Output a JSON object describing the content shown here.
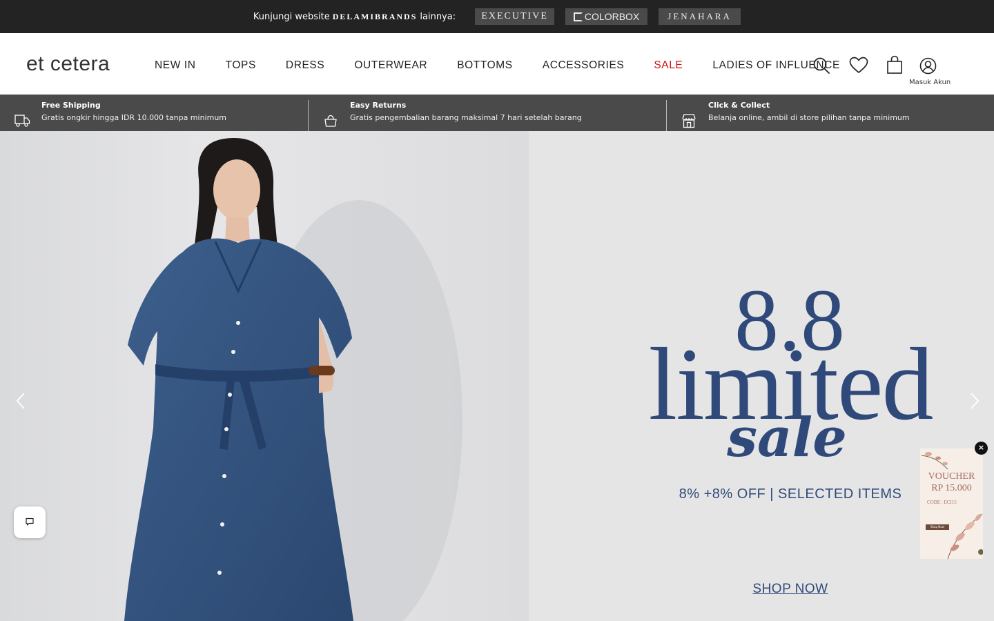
{
  "topbar": {
    "visit_text": "Kunjungi website",
    "group_brand": "DELAMIBRANDS",
    "suffix": "lainnya:",
    "brands": [
      "EXECUTIVE",
      "COLORBOX",
      "JENAHARA"
    ]
  },
  "header": {
    "logo": "et cetera",
    "nav": [
      "NEW IN",
      "TOPS",
      "DRESS",
      "OUTERWEAR",
      "BOTTOMS",
      "ACCESSORIES",
      "SALE",
      "LADIES OF INFLUENCE"
    ],
    "account_label": "Masuk Akun"
  },
  "info": {
    "items": [
      {
        "title": "Free Shipping",
        "desc": "Gratis ongkir hingga IDR 10.000 tanpa minimum",
        "icon": "truck-icon"
      },
      {
        "title": "Easy Returns",
        "desc": "Gratis pengembalian barang maksimal 7 hari setelah barang",
        "icon": "basket-icon"
      },
      {
        "title": "Click & Collect",
        "desc": "Belanja online, ambil di store pilihan tanpa minimum",
        "icon": "store-icon"
      }
    ]
  },
  "hero": {
    "headline_number": "8.8",
    "headline_word": "limited",
    "headline_script": "sale",
    "offer": "8% +8% OFF  |  SELECTED ITEMS",
    "cta": "SHOP NOW"
  },
  "voucher": {
    "title_line1": "VOUCHER",
    "title_line2": "RP 15.000",
    "code": "CODE : ECI15",
    "button": "Shop Now",
    "close": "×"
  },
  "colors": {
    "topbar_bg": "#232323",
    "infostrip_bg": "#4a4a4a",
    "sale_red": "#d10e0e",
    "hero_navy": "#2f4a7a"
  }
}
